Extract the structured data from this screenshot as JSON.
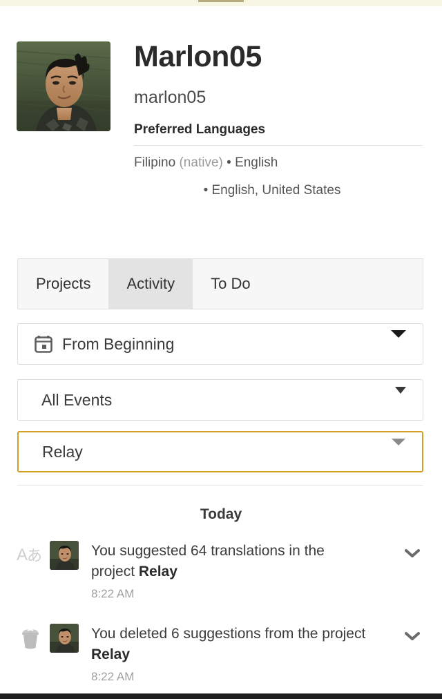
{
  "top_strip": {
    "accent_color": "#f7f5e4",
    "bar_color": "#b5ab7c"
  },
  "profile": {
    "display_name": "Marlon05",
    "username": "marlon05",
    "preferred_languages_title": "Preferred Languages",
    "languages_line_1_primary": "Filipino",
    "languages_line_1_native": "(native)",
    "languages_line_1_bullet": "•",
    "languages_line_1_secondary": "English",
    "languages_line_2": "• English, United States",
    "avatar_alt": "avatar"
  },
  "tabs": [
    {
      "label": "Projects",
      "selected": false
    },
    {
      "label": "Activity",
      "selected": true
    },
    {
      "label": "To Do",
      "selected": false
    }
  ],
  "filters": {
    "date_range": {
      "value": "From Beginning",
      "icon": "calendar-icon"
    },
    "event_type": {
      "value": "All Events"
    },
    "project": {
      "value": "Relay",
      "focused": true,
      "focus_color": "#d4a024"
    }
  },
  "feed": {
    "day_header": "Today",
    "items": [
      {
        "icon": "translate-icon",
        "icon_glyph": "Aあ",
        "text_prefix": "You suggested 64 translations in the project ",
        "project": "Relay",
        "time": "8:22 AM",
        "expand_icon": "chevron-down-icon"
      },
      {
        "icon": "trash-icon",
        "icon_glyph": "",
        "text_prefix": "You deleted 6 suggestions from the project ",
        "project": "Relay",
        "time": "8:22 AM",
        "expand_icon": "chevron-down-icon"
      }
    ]
  }
}
